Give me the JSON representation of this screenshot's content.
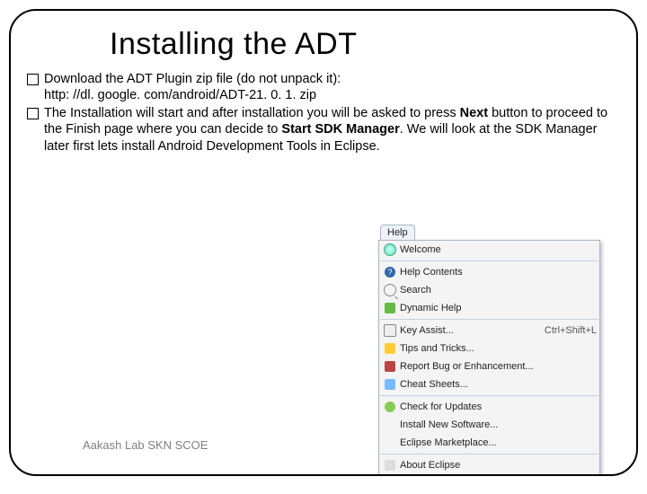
{
  "title": "Installing the ADT",
  "bullets": [
    {
      "pre": "Download the ADT Plugin zip file (do not unpack it): ",
      "url": "http: //dl. google. com/android/ADT-21. 0. 1. zip"
    },
    {
      "p1": "The Installation will start and after installation you will be asked to press ",
      "b1": "Next ",
      "p2": "button to proceed to the Finish page where you can decide to ",
      "b2": "Start SDK Manager",
      "p3": ". We will look at the SDK Manager later first lets install Android Development Tools in Eclipse."
    }
  ],
  "footer": "Aakash Lab SKN SCOE",
  "menu": {
    "tab": "Help",
    "items": [
      {
        "icon": "welcome",
        "label": "Welcome"
      },
      {
        "sep": true
      },
      {
        "icon": "help",
        "label": "Help Contents"
      },
      {
        "icon": "search",
        "label": "Search"
      },
      {
        "icon": "dyn",
        "label": "Dynamic Help"
      },
      {
        "sep": true
      },
      {
        "icon": "key",
        "label": "Key Assist...",
        "shortcut": "Ctrl+Shift+L"
      },
      {
        "icon": "tips",
        "label": "Tips and Tricks..."
      },
      {
        "icon": "bug",
        "label": "Report Bug or Enhancement..."
      },
      {
        "icon": "cheat",
        "label": "Cheat Sheets..."
      },
      {
        "sep": true
      },
      {
        "icon": "upd",
        "label": "Check for Updates"
      },
      {
        "icon": "blank",
        "label": "Install New Software..."
      },
      {
        "icon": "blank",
        "label": "Eclipse Marketplace..."
      },
      {
        "sep": true
      },
      {
        "icon": "about",
        "label": "About Eclipse"
      }
    ]
  }
}
